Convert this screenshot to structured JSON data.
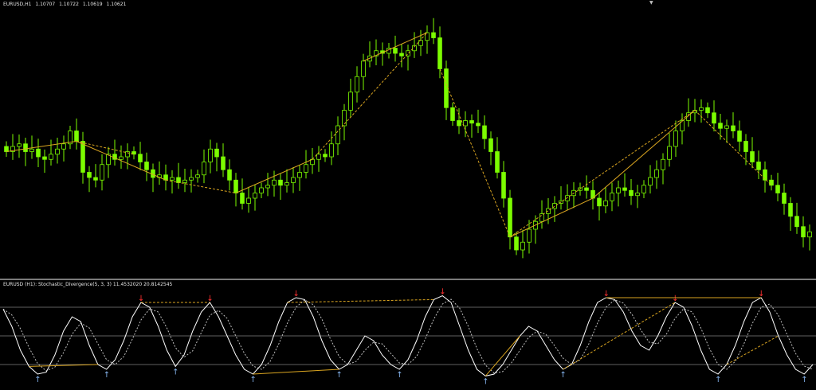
{
  "main": {
    "symbol": "EURUSD,H1",
    "ohlc": [
      "1.10707",
      "1.10722",
      "1.10619",
      "1.10621"
    ]
  },
  "sub": {
    "title": "EURUSD (H1): Stochastic_Divergence(5, 3, 3) 11.4532020 20.8142545"
  },
  "colors": {
    "background": "#000000",
    "bull_candle": "#7CFC00",
    "bear_candle": "#c8ffc8",
    "trendline": "#DAA520",
    "stoch_main": "#ffffff",
    "stoch_signal": "#bfbfbf",
    "level_lines": "#808080",
    "up_arrow": "#87b6f0",
    "down_arrow": "#ff3030"
  },
  "chart_data": [
    {
      "type": "candlestick",
      "closes": [
        1.1093,
        1.1095,
        1.1096,
        1.1093,
        1.1094,
        1.1091,
        1.109,
        1.1092,
        1.1094,
        1.1096,
        1.1101,
        1.1097,
        1.1085,
        1.1083,
        1.1082,
        1.1088,
        1.1092,
        1.109,
        1.1091,
        1.1093,
        1.1092,
        1.1089,
        1.1086,
        1.1083,
        1.1084,
        1.1082,
        1.1083,
        1.1081,
        1.1082,
        1.1083,
        1.1084,
        1.1089,
        1.1094,
        1.1091,
        1.1086,
        1.1082,
        1.1077,
        1.1073,
        1.1075,
        1.1077,
        1.1079,
        1.108,
        1.1082,
        1.108,
        1.1081,
        1.1083,
        1.1085,
        1.1088,
        1.109,
        1.1092,
        1.1091,
        1.1096,
        1.1103,
        1.1109,
        1.1116,
        1.1122,
        1.1128,
        1.113,
        1.1132,
        1.1131,
        1.1133,
        1.1131,
        1.113,
        1.1132,
        1.1134,
        1.1136,
        1.1139,
        1.1137,
        1.1125,
        1.111,
        1.1105,
        1.1103,
        1.1105,
        1.1104,
        1.1103,
        1.1098,
        1.1093,
        1.1085,
        1.1075,
        1.106,
        1.1055,
        1.1058,
        1.1063,
        1.1066,
        1.1069,
        1.1071,
        1.1073,
        1.1074,
        1.1076,
        1.1078,
        1.1079,
        1.1078,
        1.1075,
        1.1072,
        1.1074,
        1.1077,
        1.1079,
        1.1078,
        1.1076,
        1.1077,
        1.108,
        1.1083,
        1.1086,
        1.109,
        1.1095,
        1.1101,
        1.1105,
        1.1108,
        1.1109,
        1.111,
        1.1108,
        1.1104,
        1.1102,
        1.1103,
        1.1101,
        1.1097,
        1.1093,
        1.1089,
        1.1086,
        1.1082,
        1.108,
        1.1077,
        1.1073,
        1.1068,
        1.1064,
        1.106,
        1.1062
      ],
      "highs_offset": 0.0004,
      "lows_offset": 0.0004
    },
    {
      "type": "line",
      "series": [
        {
          "values": [
            78,
            60,
            35,
            18,
            10,
            12,
            30,
            55,
            70,
            65,
            40,
            20,
            15,
            25,
            45,
            70,
            85,
            80,
            60,
            35,
            18,
            30,
            55,
            75,
            85,
            70,
            50,
            30,
            15,
            10,
            20,
            40,
            65,
            85,
            90,
            88,
            70,
            45,
            25,
            15,
            20,
            35,
            50,
            45,
            30,
            20,
            15,
            25,
            45,
            70,
            88,
            92,
            85,
            60,
            35,
            15,
            8,
            10,
            20,
            35,
            50,
            60,
            55,
            40,
            25,
            15,
            20,
            40,
            65,
            85,
            90,
            88,
            75,
            55,
            40,
            35,
            50,
            70,
            85,
            80,
            60,
            35,
            15,
            10,
            20,
            40,
            65,
            85,
            90,
            75,
            50,
            30,
            15,
            10,
            20
          ]
        }
      ],
      "levels": [
        80,
        50,
        20
      ],
      "ylim": [
        0,
        100
      ]
    }
  ]
}
